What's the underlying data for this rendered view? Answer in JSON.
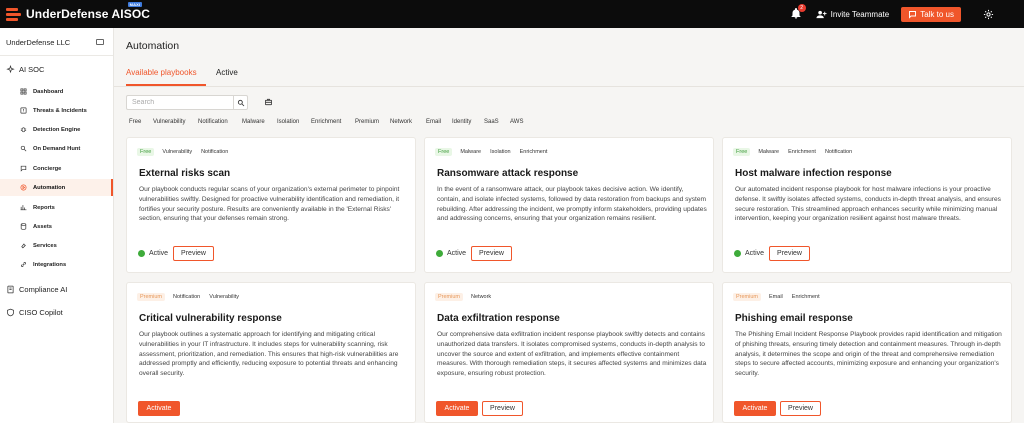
{
  "header": {
    "brand": "UnderDefense AISOC",
    "brand_badge": "MAXI",
    "notification_count": "2",
    "invite_label": "Invite Teammate",
    "talk_label": "Talk to us"
  },
  "sidebar": {
    "org": "UnderDefense LLC",
    "section_ai_soc": "AI SOC",
    "items": [
      {
        "label": "Dashboard",
        "icon": "grid-icon"
      },
      {
        "label": "Threats & Incidents",
        "icon": "alert-icon"
      },
      {
        "label": "Detection Engine",
        "icon": "bug-icon"
      },
      {
        "label": "On Demand Hunt",
        "icon": "search-icon"
      },
      {
        "label": "Concierge",
        "icon": "chat-icon"
      },
      {
        "label": "Automation",
        "icon": "play-icon"
      },
      {
        "label": "Reports",
        "icon": "bar-chart-icon"
      },
      {
        "label": "Assets",
        "icon": "database-icon"
      },
      {
        "label": "Services",
        "icon": "wrench-icon"
      },
      {
        "label": "Integrations",
        "icon": "link-icon"
      }
    ],
    "section_compliance": "Compliance AI",
    "section_ciso": "CISO Copilot"
  },
  "main": {
    "title": "Automation",
    "tabs": [
      "Available playbooks",
      "Active"
    ],
    "search_placeholder": "Search",
    "filters": [
      "Free",
      "Vulnerability",
      "Notification",
      "Malware",
      "Isolation",
      "Enrichment",
      "Premium",
      "Network",
      "Email",
      "Identity",
      "SaaS",
      "AWS"
    ]
  },
  "cards": [
    {
      "tags": [
        "Free",
        "Vulnerability",
        "Notification"
      ],
      "title": "External risks scan",
      "desc": "Our playbook conducts regular scans of your organization's external perimeter to pinpoint vulnerabilities swiftly. Designed for proactive vulnerability identification and remediation, it fortifies your security posture. Results are conveniently available in the 'External Risks' section, ensuring that your defenses remain strong.",
      "status": "Active",
      "preview": "Preview"
    },
    {
      "tags": [
        "Free",
        "Malware",
        "Isolation",
        "Enrichment"
      ],
      "title": "Ransomware attack response",
      "desc": "In the event of a ransomware attack, our playbook takes decisive action. We identify, contain, and isolate infected systems, followed by data restoration from backups and system rebuilding. After addressing the incident, we promptly inform stakeholders, providing updates and addressing concerns, ensuring that your organization remains resilient.",
      "status": "Active",
      "preview": "Preview"
    },
    {
      "tags": [
        "Free",
        "Malware",
        "Enrichment",
        "Notification"
      ],
      "title": "Host malware infection response",
      "desc": "Our automated incident response playbook for host malware infections is your proactive defense. It swiftly isolates affected systems, conducts in-depth threat analysis, and ensures secure restoration. This streamlined approach enhances security while minimizing manual intervention, keeping your organization resilient against host malware threats.",
      "status": "Active",
      "preview": "Preview"
    },
    {
      "tags": [
        "Premium",
        "Notification",
        "Vulnerability"
      ],
      "title": "Critical vulnerability response",
      "desc": "Our playbook outlines a systematic approach for identifying and mitigating critical vulnerabilities in your IT infrastructure. It includes steps for vulnerability scanning, risk assessment, prioritization, and remediation. This ensures that high-risk vulnerabilities are addressed promptly and efficiently, reducing exposure to potential threats and enhancing overall security.",
      "activate": "Activate"
    },
    {
      "tags": [
        "Premium",
        "Network"
      ],
      "title": "Data exfiltration response",
      "desc": "Our comprehensive data exfiltration incident response playbook swiftly detects and contains unauthorized data transfers. It isolates compromised systems, conducts in-depth analysis to uncover the source and extent of exfiltration, and implements effective containment measures. With thorough remediation steps, it secures affected systems and minimizes data exposure, ensuring robust protection.",
      "activate": "Activate",
      "preview": "Preview"
    },
    {
      "tags": [
        "Premium",
        "Email",
        "Enrichment"
      ],
      "title": "Phishing email response",
      "desc": "The Phishing Email Incident Response Playbook provides rapid identification and mitigation of phishing threats, ensuring timely detection and containment measures. Through in-depth analysis, it determines the scope and origin of the threat and comprehensive remediation steps to secure affected accounts, minimizing exposure and enhancing your organization's security.",
      "activate": "Activate",
      "preview": "Preview"
    }
  ]
}
